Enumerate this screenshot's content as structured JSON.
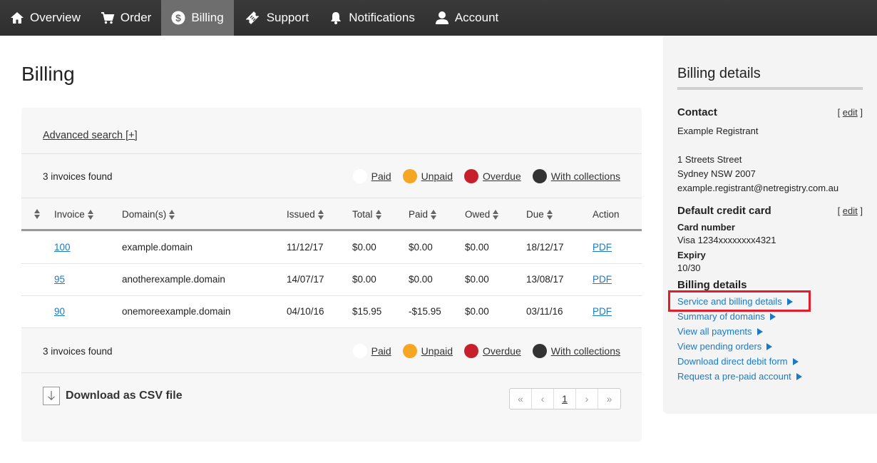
{
  "nav": {
    "items": [
      {
        "label": "Overview",
        "icon": "home-icon"
      },
      {
        "label": "Order",
        "icon": "cart-icon"
      },
      {
        "label": "Billing",
        "icon": "dollar-icon"
      },
      {
        "label": "Support",
        "icon": "ticket-icon"
      },
      {
        "label": "Notifications",
        "icon": "bell-icon"
      },
      {
        "label": "Account",
        "icon": "user-icon"
      }
    ],
    "active": "Billing"
  },
  "page": {
    "title": "Billing"
  },
  "search": {
    "advanced_label": "Advanced search [+]"
  },
  "summary": {
    "count_text": "3 invoices found",
    "legend": [
      {
        "label": "Paid",
        "color": "#ffffff"
      },
      {
        "label": "Unpaid",
        "color": "#f5a623"
      },
      {
        "label": "Overdue",
        "color": "#c8202a"
      },
      {
        "label": "With collections",
        "color": "#333333"
      }
    ]
  },
  "table": {
    "columns": [
      "",
      "Invoice",
      "Domain(s)",
      "Issued",
      "Total",
      "Paid",
      "Owed",
      "Due",
      "Action"
    ],
    "rows": [
      {
        "invoice": "100",
        "domain": "example.domain",
        "issued": "11/12/17",
        "total": "$0.00",
        "paid": "$0.00",
        "owed": "$0.00",
        "due": "18/12/17",
        "action": "PDF"
      },
      {
        "invoice": "95",
        "domain": "anotherexample.domain",
        "issued": "14/07/17",
        "total": "$0.00",
        "paid": "$0.00",
        "owed": "$0.00",
        "due": "13/08/17",
        "action": "PDF"
      },
      {
        "invoice": "90",
        "domain": "onemoreexample.domain",
        "issued": "04/10/16",
        "total": "$15.95",
        "paid": "-$15.95",
        "owed": "$0.00",
        "due": "03/11/16",
        "action": "PDF"
      }
    ]
  },
  "download": {
    "label": "Download as CSV file"
  },
  "pagination": {
    "first": "«",
    "prev": "‹",
    "current": "1",
    "next": "›",
    "last": "»"
  },
  "sidebar": {
    "title": "Billing details",
    "contact": {
      "heading": "Contact",
      "edit": "edit",
      "name": "Example Registrant",
      "street": "1 Streets Street",
      "city": "Sydney NSW 2007",
      "email": "example.registrant@netregistry.com.au"
    },
    "card": {
      "heading": "Default credit card",
      "edit": "edit",
      "number_label": "Card number",
      "number": "Visa 1234xxxxxxxx4321",
      "expiry_label": "Expiry",
      "expiry": "10/30"
    },
    "billing": {
      "heading": "Billing details",
      "links": [
        "Service and billing details",
        "Summary of domains",
        "View all payments",
        "View pending orders",
        "Download direct debit form",
        "Request a pre-paid account"
      ]
    },
    "highlight_color": "#e01e2c"
  }
}
